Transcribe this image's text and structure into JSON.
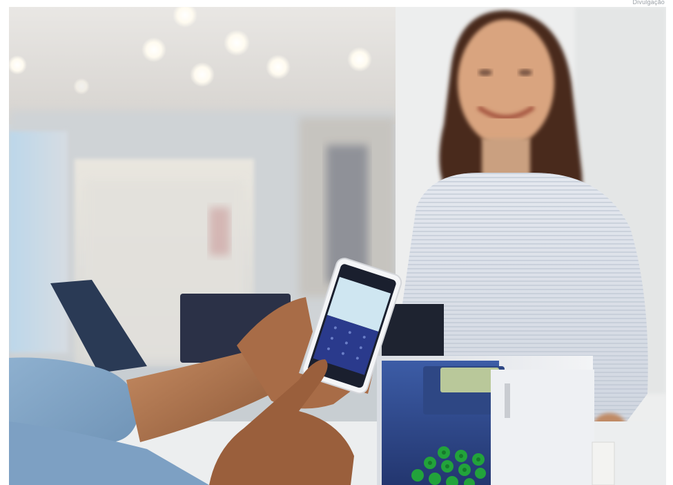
{
  "image": {
    "credit": "Divulgação",
    "description_icon": "photo-icon"
  },
  "colors": {
    "ceiling": "#e7e6e4",
    "store_wall": "#c8cdd2",
    "terminal_body": "#e9ecf0",
    "terminal_accent": "#2c4a8a",
    "keypad_green": "#22a33b",
    "phone_screen_top": "#c9e3ef",
    "phone_keypad": "#2a3a8c",
    "shirt": "#dfe3ea",
    "skin": "#b3774f"
  }
}
